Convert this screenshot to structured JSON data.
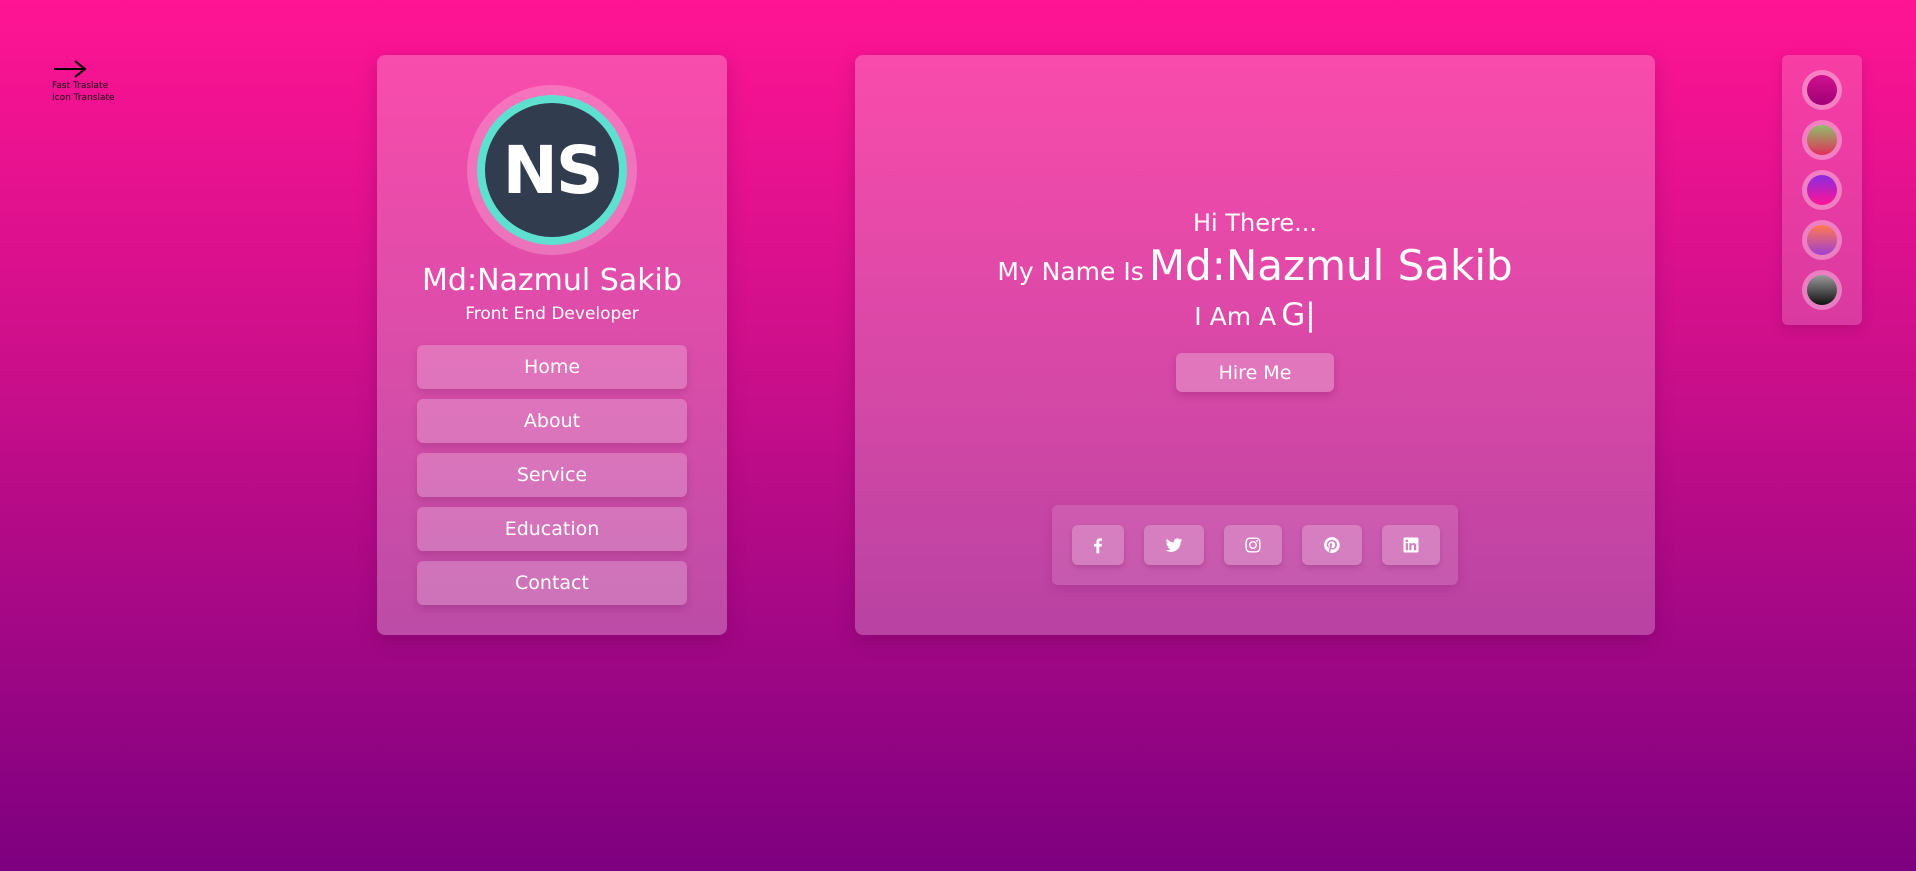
{
  "translate": {
    "icon": "right-arrow-icon",
    "line1": "Fast Traslate",
    "line2": "Icon Translate"
  },
  "profile": {
    "initials": "NS",
    "name": "Md:Nazmul Sakib",
    "role": "Front End Developer",
    "nav": [
      {
        "label": "Home"
      },
      {
        "label": "About"
      },
      {
        "label": "Service"
      },
      {
        "label": "Education"
      },
      {
        "label": "Contact"
      }
    ]
  },
  "hero": {
    "greeting": "Hi There...",
    "name_prefix": "My Name Is",
    "name": "Md:Nazmul Sakib",
    "role_prefix": "I Am A",
    "role_typed": "G|",
    "hire_label": "Hire Me",
    "social": [
      {
        "icon": "facebook-icon"
      },
      {
        "icon": "twitter-icon"
      },
      {
        "icon": "instagram-icon"
      },
      {
        "icon": "pinterest-icon"
      },
      {
        "icon": "linkedin-icon"
      }
    ]
  },
  "themes": [
    {
      "name": "theme-swatch-pink",
      "colors": [
        "#d0108c",
        "#a00078"
      ]
    },
    {
      "name": "theme-swatch-green-red",
      "colors": [
        "#8fbf6a",
        "#e0305a"
      ]
    },
    {
      "name": "theme-swatch-purple-pink",
      "colors": [
        "#8a2be2",
        "#ff1493"
      ]
    },
    {
      "name": "theme-swatch-orange-purple",
      "colors": [
        "#ff7a50",
        "#a040d0"
      ]
    },
    {
      "name": "theme-swatch-gray-black",
      "colors": [
        "#9a9a9a",
        "#111111"
      ]
    }
  ],
  "colors": {
    "background_top": "#ff1493",
    "background_bottom": "#7d0080",
    "avatar_ring": "#5ee0d0",
    "avatar_fill": "#313c4e"
  }
}
